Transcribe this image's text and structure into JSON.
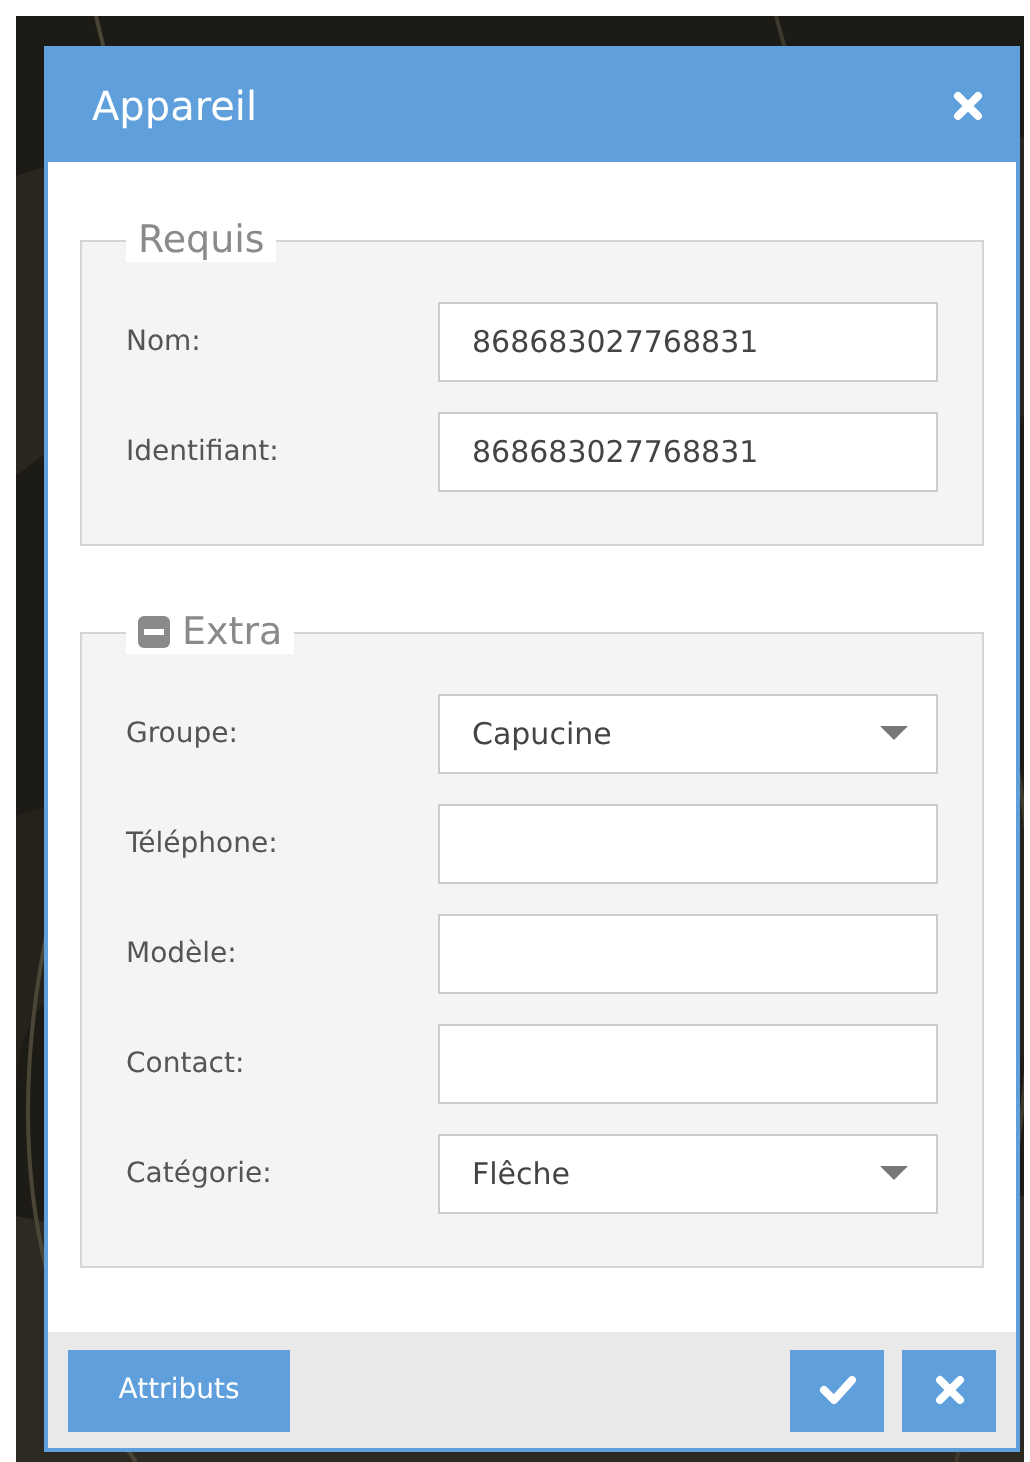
{
  "dialog": {
    "title": "Appareil"
  },
  "sections": [
    {
      "legend": "Requis",
      "fields": [
        {
          "label": "Nom:",
          "kind": "text",
          "value": "868683027768831"
        },
        {
          "label": "Identifiant:",
          "kind": "text",
          "value": "868683027768831"
        }
      ]
    },
    {
      "legend": "Extra",
      "expanded": true,
      "fields": [
        {
          "label": "Groupe:",
          "kind": "select",
          "value": "Capucine"
        },
        {
          "label": "Téléphone:",
          "kind": "text"
        },
        {
          "label": "Modèle:",
          "kind": "text"
        },
        {
          "label": "Contact:",
          "kind": "text"
        },
        {
          "label": "Catégorie:",
          "kind": "select",
          "value": "Flêche"
        }
      ]
    }
  ],
  "footer": {
    "attributes_button": "Attributs"
  }
}
